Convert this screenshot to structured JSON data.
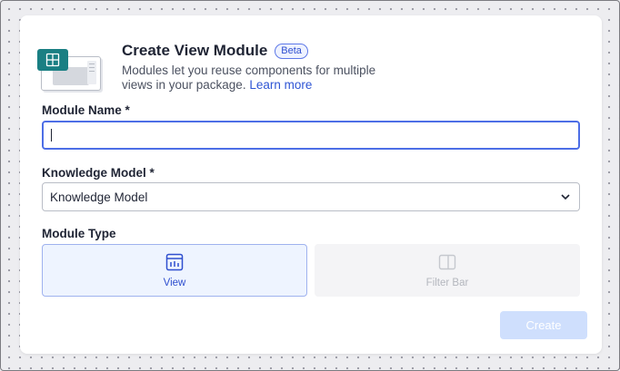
{
  "modal": {
    "title": "Create View Module",
    "badge": "Beta",
    "description": "Modules let you reuse components for multiple views in your package.",
    "learn_more": "Learn more"
  },
  "form": {
    "module_name": {
      "label": "Module Name *",
      "value": ""
    },
    "knowledge_model": {
      "label": "Knowledge Model *",
      "selected": "Knowledge Model"
    },
    "module_type": {
      "label": "Module Type",
      "options": [
        {
          "label": "View",
          "selected": true,
          "icon": "view-module-icon"
        },
        {
          "label": "Filter Bar",
          "selected": false,
          "disabled": true,
          "icon": "filter-bar-icon"
        }
      ]
    }
  },
  "footer": {
    "create_label": "Create",
    "create_enabled": false
  },
  "colors": {
    "accent": "#2f4fcf",
    "teal": "#1a7f83",
    "focus_border": "#4d6ee6"
  }
}
